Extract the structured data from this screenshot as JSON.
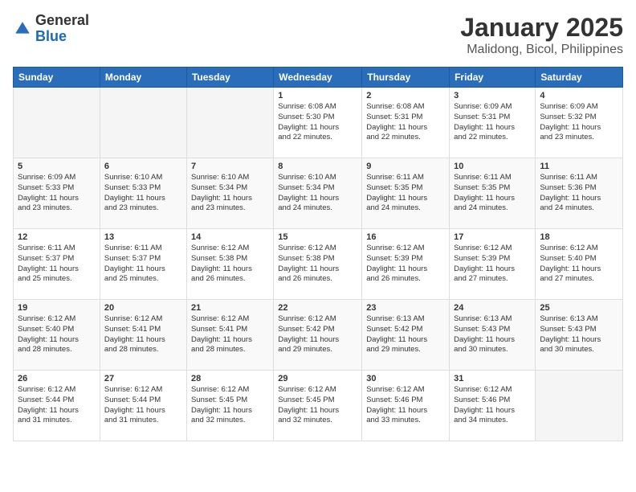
{
  "logo": {
    "general": "General",
    "blue": "Blue"
  },
  "header": {
    "month": "January 2025",
    "location": "Malidong, Bicol, Philippines"
  },
  "weekdays": [
    "Sunday",
    "Monday",
    "Tuesday",
    "Wednesday",
    "Thursday",
    "Friday",
    "Saturday"
  ],
  "weeks": [
    [
      {
        "day": "",
        "info": ""
      },
      {
        "day": "",
        "info": ""
      },
      {
        "day": "",
        "info": ""
      },
      {
        "day": "1",
        "info": "Sunrise: 6:08 AM\nSunset: 5:30 PM\nDaylight: 11 hours\nand 22 minutes."
      },
      {
        "day": "2",
        "info": "Sunrise: 6:08 AM\nSunset: 5:31 PM\nDaylight: 11 hours\nand 22 minutes."
      },
      {
        "day": "3",
        "info": "Sunrise: 6:09 AM\nSunset: 5:31 PM\nDaylight: 11 hours\nand 22 minutes."
      },
      {
        "day": "4",
        "info": "Sunrise: 6:09 AM\nSunset: 5:32 PM\nDaylight: 11 hours\nand 23 minutes."
      }
    ],
    [
      {
        "day": "5",
        "info": "Sunrise: 6:09 AM\nSunset: 5:33 PM\nDaylight: 11 hours\nand 23 minutes."
      },
      {
        "day": "6",
        "info": "Sunrise: 6:10 AM\nSunset: 5:33 PM\nDaylight: 11 hours\nand 23 minutes."
      },
      {
        "day": "7",
        "info": "Sunrise: 6:10 AM\nSunset: 5:34 PM\nDaylight: 11 hours\nand 23 minutes."
      },
      {
        "day": "8",
        "info": "Sunrise: 6:10 AM\nSunset: 5:34 PM\nDaylight: 11 hours\nand 24 minutes."
      },
      {
        "day": "9",
        "info": "Sunrise: 6:11 AM\nSunset: 5:35 PM\nDaylight: 11 hours\nand 24 minutes."
      },
      {
        "day": "10",
        "info": "Sunrise: 6:11 AM\nSunset: 5:35 PM\nDaylight: 11 hours\nand 24 minutes."
      },
      {
        "day": "11",
        "info": "Sunrise: 6:11 AM\nSunset: 5:36 PM\nDaylight: 11 hours\nand 24 minutes."
      }
    ],
    [
      {
        "day": "12",
        "info": "Sunrise: 6:11 AM\nSunset: 5:37 PM\nDaylight: 11 hours\nand 25 minutes."
      },
      {
        "day": "13",
        "info": "Sunrise: 6:11 AM\nSunset: 5:37 PM\nDaylight: 11 hours\nand 25 minutes."
      },
      {
        "day": "14",
        "info": "Sunrise: 6:12 AM\nSunset: 5:38 PM\nDaylight: 11 hours\nand 26 minutes."
      },
      {
        "day": "15",
        "info": "Sunrise: 6:12 AM\nSunset: 5:38 PM\nDaylight: 11 hours\nand 26 minutes."
      },
      {
        "day": "16",
        "info": "Sunrise: 6:12 AM\nSunset: 5:39 PM\nDaylight: 11 hours\nand 26 minutes."
      },
      {
        "day": "17",
        "info": "Sunrise: 6:12 AM\nSunset: 5:39 PM\nDaylight: 11 hours\nand 27 minutes."
      },
      {
        "day": "18",
        "info": "Sunrise: 6:12 AM\nSunset: 5:40 PM\nDaylight: 11 hours\nand 27 minutes."
      }
    ],
    [
      {
        "day": "19",
        "info": "Sunrise: 6:12 AM\nSunset: 5:40 PM\nDaylight: 11 hours\nand 28 minutes."
      },
      {
        "day": "20",
        "info": "Sunrise: 6:12 AM\nSunset: 5:41 PM\nDaylight: 11 hours\nand 28 minutes."
      },
      {
        "day": "21",
        "info": "Sunrise: 6:12 AM\nSunset: 5:41 PM\nDaylight: 11 hours\nand 28 minutes."
      },
      {
        "day": "22",
        "info": "Sunrise: 6:12 AM\nSunset: 5:42 PM\nDaylight: 11 hours\nand 29 minutes."
      },
      {
        "day": "23",
        "info": "Sunrise: 6:13 AM\nSunset: 5:42 PM\nDaylight: 11 hours\nand 29 minutes."
      },
      {
        "day": "24",
        "info": "Sunrise: 6:13 AM\nSunset: 5:43 PM\nDaylight: 11 hours\nand 30 minutes."
      },
      {
        "day": "25",
        "info": "Sunrise: 6:13 AM\nSunset: 5:43 PM\nDaylight: 11 hours\nand 30 minutes."
      }
    ],
    [
      {
        "day": "26",
        "info": "Sunrise: 6:12 AM\nSunset: 5:44 PM\nDaylight: 11 hours\nand 31 minutes."
      },
      {
        "day": "27",
        "info": "Sunrise: 6:12 AM\nSunset: 5:44 PM\nDaylight: 11 hours\nand 31 minutes."
      },
      {
        "day": "28",
        "info": "Sunrise: 6:12 AM\nSunset: 5:45 PM\nDaylight: 11 hours\nand 32 minutes."
      },
      {
        "day": "29",
        "info": "Sunrise: 6:12 AM\nSunset: 5:45 PM\nDaylight: 11 hours\nand 32 minutes."
      },
      {
        "day": "30",
        "info": "Sunrise: 6:12 AM\nSunset: 5:46 PM\nDaylight: 11 hours\nand 33 minutes."
      },
      {
        "day": "31",
        "info": "Sunrise: 6:12 AM\nSunset: 5:46 PM\nDaylight: 11 hours\nand 34 minutes."
      },
      {
        "day": "",
        "info": ""
      }
    ]
  ]
}
